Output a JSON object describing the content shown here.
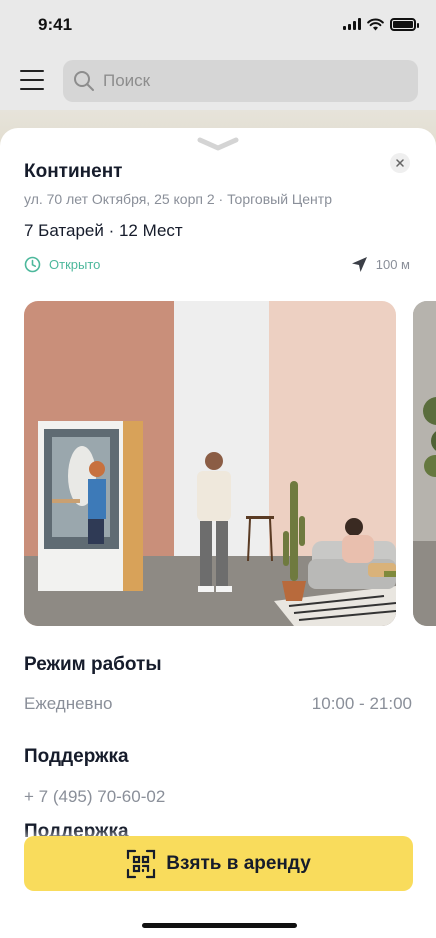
{
  "status_bar": {
    "time": "9:41"
  },
  "search": {
    "placeholder": "Поиск"
  },
  "place": {
    "title": "Континент",
    "address": "ул. 70 лет Октября, 25 корп 2 · Торговый Центр",
    "stats": "7 Батарей · 12 Мест",
    "status": "Открыто",
    "distance": "100 м"
  },
  "schedule": {
    "title": "Режим работы",
    "label": "Ежедневно",
    "hours": "10:00 - 21:00"
  },
  "support": {
    "title": "Поддержка",
    "phone": "+ 7 (495) 70-60-02",
    "next_title": "Поддержка"
  },
  "action": {
    "rent_label": "Взять в аренду"
  },
  "colors": {
    "accent_yellow": "#f9dc5c",
    "open_green": "#4db89c",
    "text_dark": "#161c2b",
    "text_muted": "#8a8f99"
  },
  "icons": [
    "menu-icon",
    "search-icon",
    "chevron-down-icon",
    "close-icon",
    "clock-icon",
    "location-arrow-icon",
    "qr-code-icon"
  ]
}
